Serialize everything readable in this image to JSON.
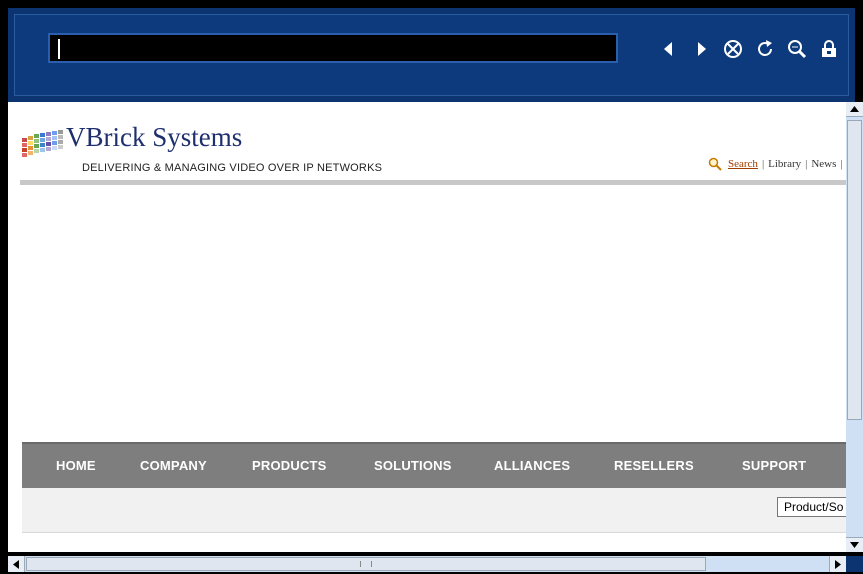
{
  "browser": {
    "url_value": "",
    "icons": [
      "back-icon",
      "forward-icon",
      "stop-icon",
      "reload-icon",
      "zoom-icon",
      "lock-icon"
    ],
    "chrome_color": "#0b3470"
  },
  "site": {
    "brand": "VBrick Systems",
    "tagline": "DELIVERING & MANAGING VIDEO OVER IP NETWORKS",
    "toplinks": {
      "search": "Search",
      "library": "Library",
      "news": "News"
    }
  },
  "nav": {
    "items": [
      "HOME",
      "COMPANY",
      "PRODUCTS",
      "SOLUTIONS",
      "ALLIANCES",
      "RESELLERS",
      "SUPPORT"
    ]
  },
  "subbar": {
    "product_select": "Product/So"
  }
}
